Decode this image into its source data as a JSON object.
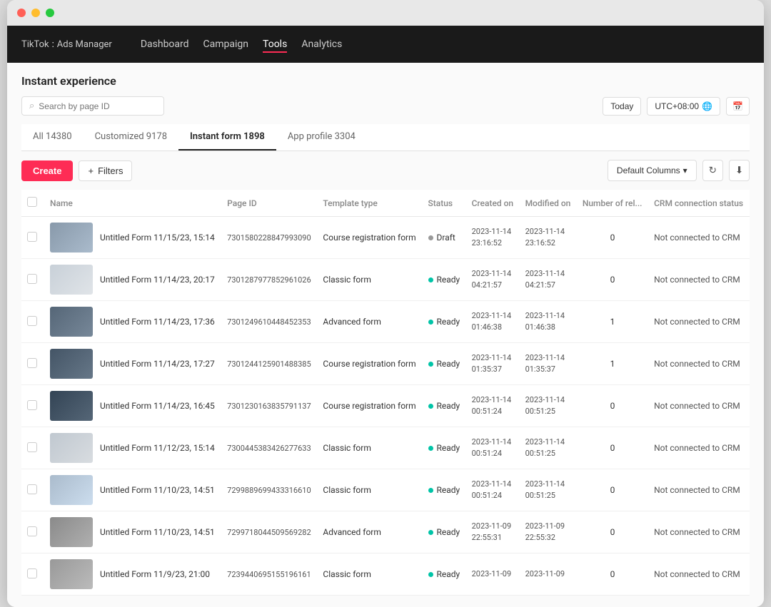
{
  "brand": {
    "logo": "TikTok",
    "colon": ":",
    "product": "Ads Manager"
  },
  "nav": {
    "items": [
      {
        "label": "Dashboard",
        "active": false
      },
      {
        "label": "Campaign",
        "active": false
      },
      {
        "label": "Tools",
        "active": true
      },
      {
        "label": "Analytics",
        "active": false
      }
    ]
  },
  "page": {
    "title": "Instant experience"
  },
  "search": {
    "placeholder": "Search by page ID"
  },
  "toolbar": {
    "today_label": "Today",
    "timezone": "UTC+08:00"
  },
  "tabs": [
    {
      "label": "All 14380",
      "active": false
    },
    {
      "label": "Customized 9178",
      "active": false
    },
    {
      "label": "Instant form 1898",
      "active": true
    },
    {
      "label": "App profile 3304",
      "active": false
    }
  ],
  "actions": {
    "create_label": "Create",
    "filters_label": "Filters",
    "columns_label": "Default Columns"
  },
  "table": {
    "columns": [
      "Name",
      "Page ID",
      "Template type",
      "Status",
      "Created on",
      "Modified on",
      "Number of rel...",
      "CRM connection status"
    ],
    "rows": [
      {
        "name": "Untitled Form 11/15/23, 15:14",
        "page_id": "7301580228847993090",
        "template": "Course registration form",
        "status": "Draft",
        "status_type": "draft",
        "created": "2023-11-14\n23:16:52",
        "modified": "2023-11-14\n23:16:52",
        "rel_count": "0",
        "crm": "Not connected to CRM",
        "thumb_color1": "#8899aa",
        "thumb_color2": "#aabbcc"
      },
      {
        "name": "Untitled Form 11/14/23, 20:17",
        "page_id": "7301287977852961026",
        "template": "Classic form",
        "status": "Ready",
        "status_type": "ready",
        "created": "2023-11-14\n04:21:57",
        "modified": "2023-11-14\n04:21:57",
        "rel_count": "0",
        "crm": "Not connected to CRM",
        "thumb_color1": "#c8d0d8",
        "thumb_color2": "#e0e4e8"
      },
      {
        "name": "Untitled Form 11/14/23, 17:36",
        "page_id": "7301249610448452353",
        "template": "Advanced form",
        "status": "Ready",
        "status_type": "ready",
        "created": "2023-11-14\n01:46:38",
        "modified": "2023-11-14\n01:46:38",
        "rel_count": "1",
        "crm": "Not connected to CRM",
        "thumb_color1": "#556677",
        "thumb_color2": "#778899"
      },
      {
        "name": "Untitled Form 11/14/23, 17:27",
        "page_id": "7301244125901488385",
        "template": "Course registration form",
        "status": "Ready",
        "status_type": "ready",
        "created": "2023-11-14\n01:35:37",
        "modified": "2023-11-14\n01:35:37",
        "rel_count": "1",
        "crm": "Not connected to CRM",
        "thumb_color1": "#445566",
        "thumb_color2": "#667788"
      },
      {
        "name": "Untitled Form 11/14/23, 16:45",
        "page_id": "7301230163835791137",
        "template": "Course registration form",
        "status": "Ready",
        "status_type": "ready",
        "created": "2023-11-14\n00:51:24",
        "modified": "2023-11-14\n00:51:25",
        "rel_count": "0",
        "crm": "Not connected to CRM",
        "thumb_color1": "#334455",
        "thumb_color2": "#556677"
      },
      {
        "name": "Untitled Form 11/12/23, 15:14",
        "page_id": "7300445383426277633",
        "template": "Classic form",
        "status": "Ready",
        "status_type": "ready",
        "created": "2023-11-14\n00:51:24",
        "modified": "2023-11-14\n00:51:25",
        "rel_count": "0",
        "crm": "Not connected to CRM",
        "thumb_color1": "#c0c8d0",
        "thumb_color2": "#d8dce0"
      },
      {
        "name": "Untitled Form 11/10/23, 14:51",
        "page_id": "7299889699433316610",
        "template": "Classic form",
        "status": "Ready",
        "status_type": "ready",
        "created": "2023-11-14\n00:51:24",
        "modified": "2023-11-14\n00:51:25",
        "rel_count": "0",
        "crm": "Not connected to CRM",
        "thumb_color1": "#aabbcc",
        "thumb_color2": "#ccddee"
      },
      {
        "name": "Untitled Form 11/10/23, 14:51",
        "page_id": "7299718044509569282",
        "template": "Advanced form",
        "status": "Ready",
        "status_type": "ready",
        "created": "2023-11-09\n22:55:31",
        "modified": "2023-11-09\n22:55:32",
        "rel_count": "0",
        "crm": "Not connected to CRM",
        "thumb_color1": "#8a8a8a",
        "thumb_color2": "#b0b0b0"
      },
      {
        "name": "Untitled Form 11/9/23, 21:00",
        "page_id": "7239440695155196161",
        "template": "Classic form",
        "status": "Ready",
        "status_type": "ready",
        "created": "2023-11-09",
        "modified": "2023-11-09",
        "rel_count": "0",
        "crm": "Not connected to CRM",
        "thumb_color1": "#999",
        "thumb_color2": "#bbb"
      }
    ]
  }
}
